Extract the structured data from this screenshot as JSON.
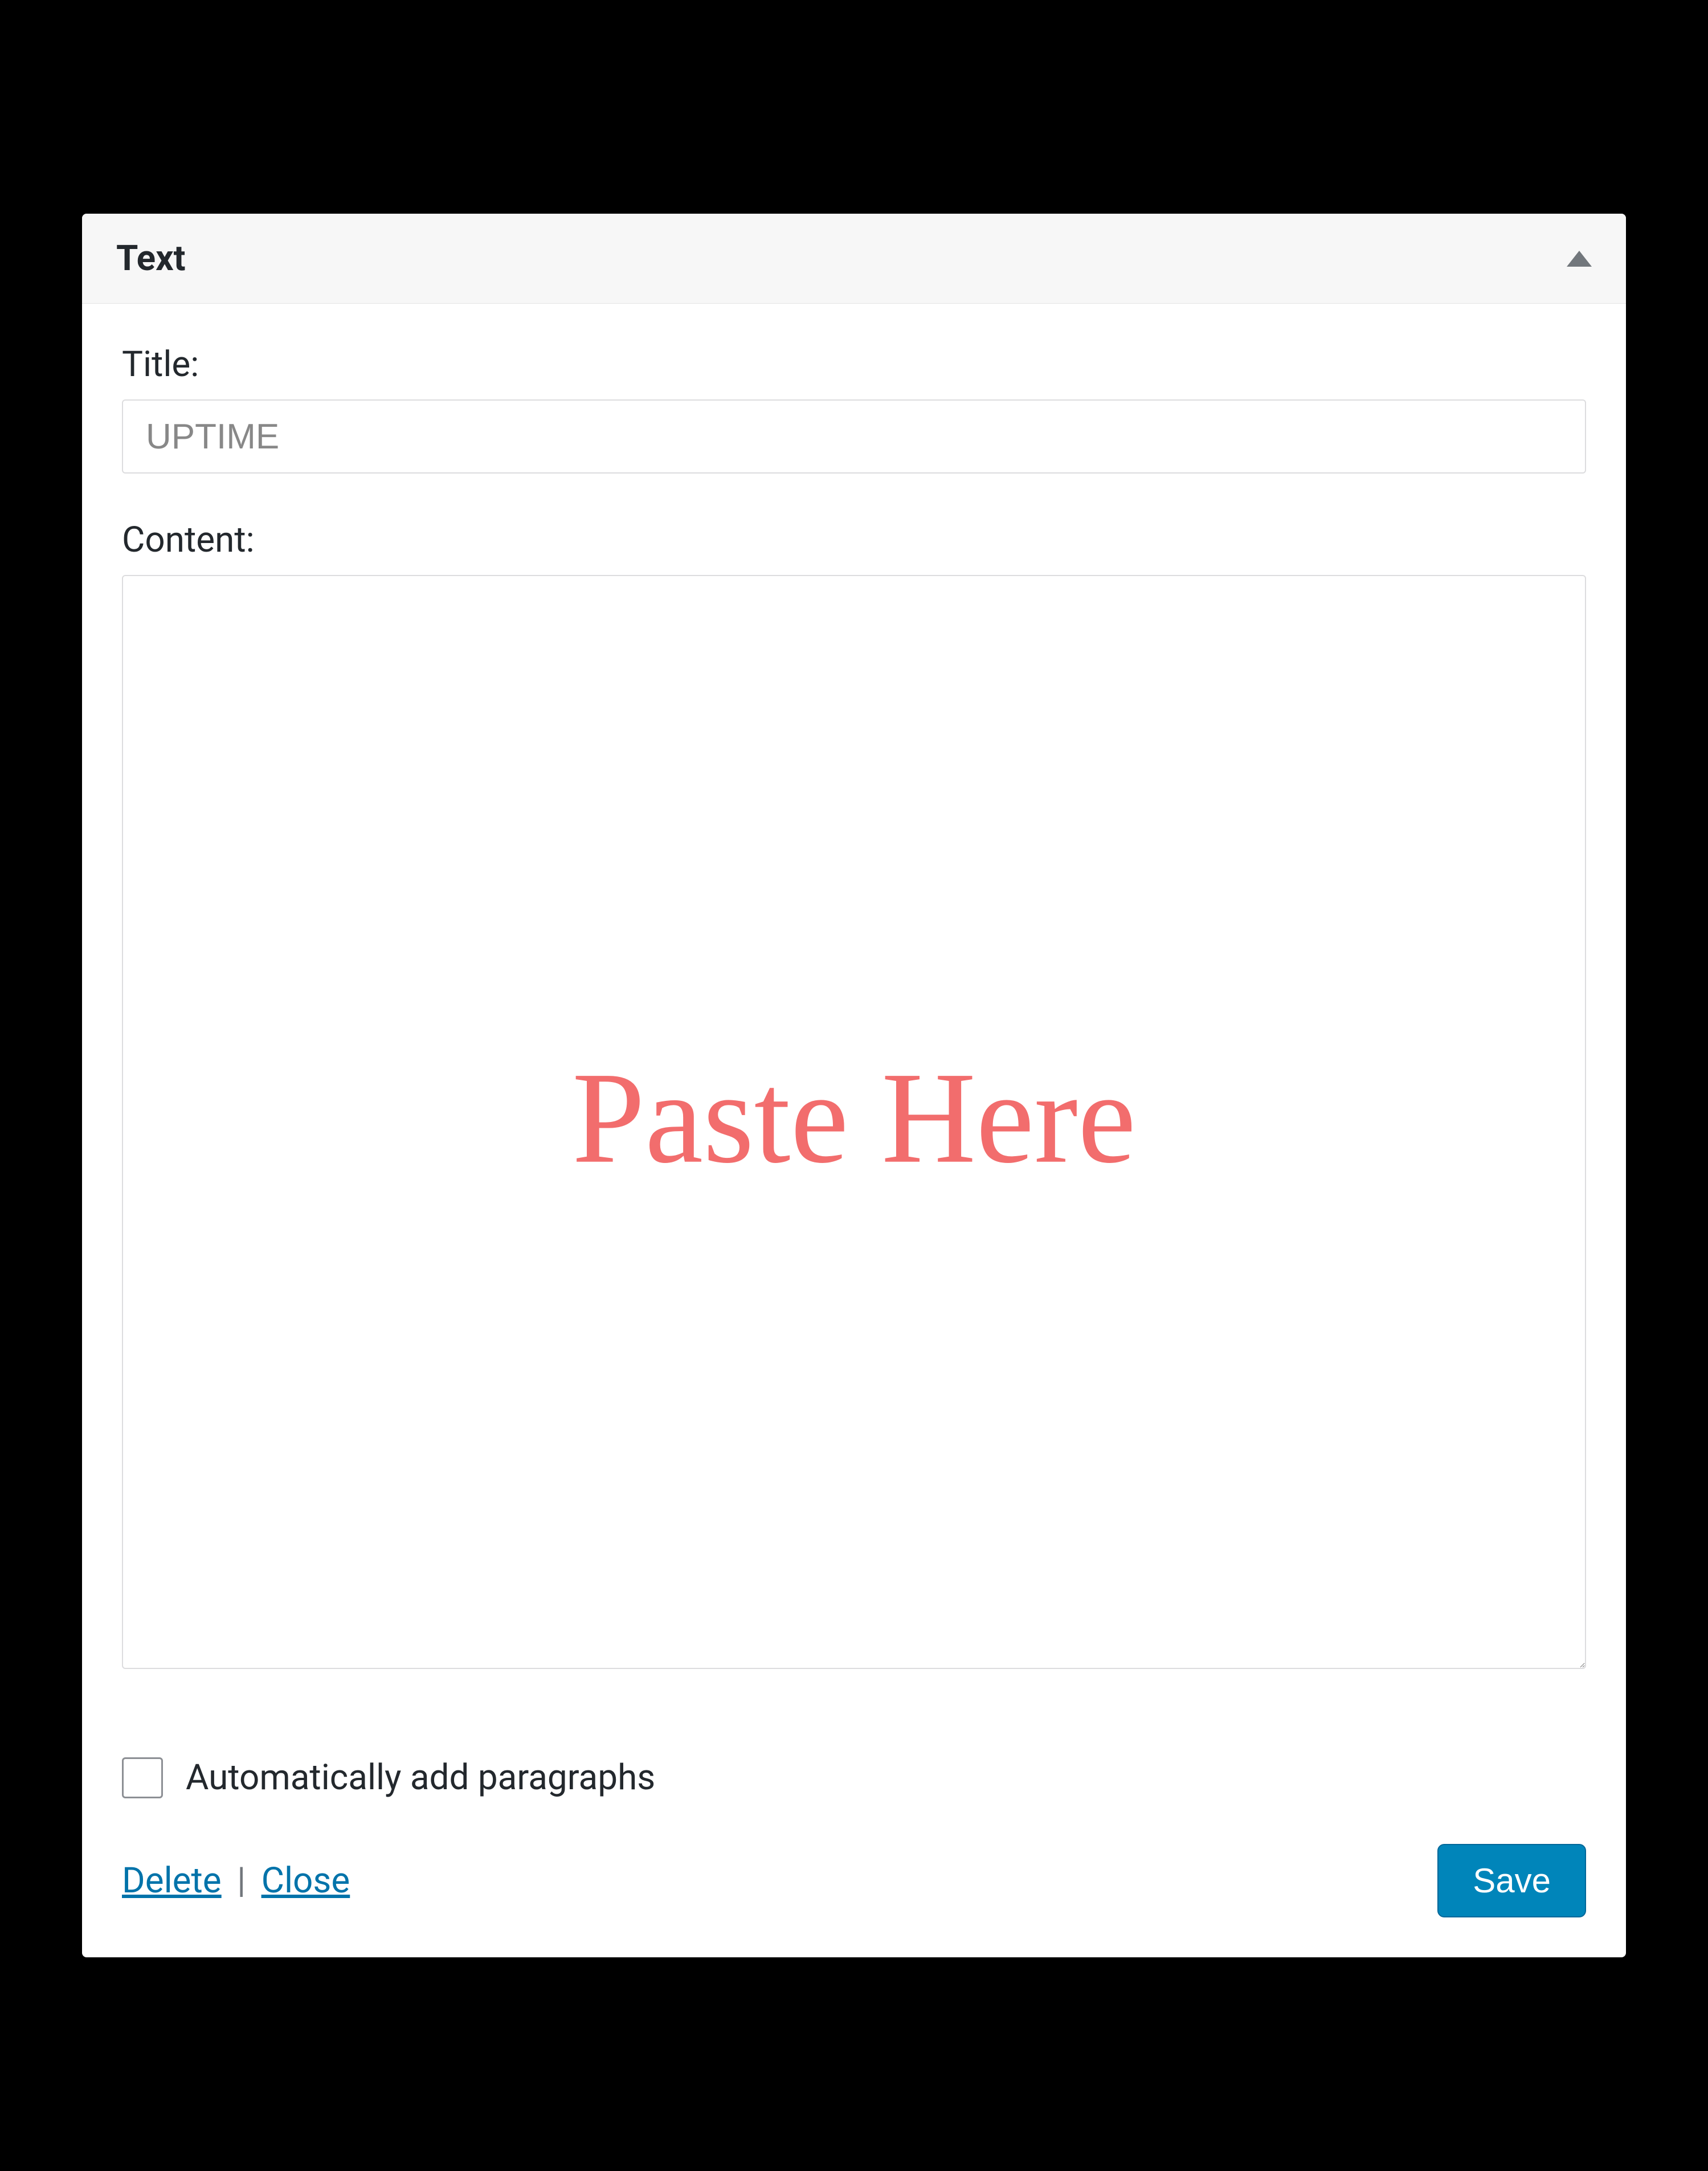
{
  "widget": {
    "header_title": "Text",
    "title_label": "Title:",
    "title_value": "UPTIME",
    "content_label": "Content:",
    "content_value": "",
    "paste_overlay": "Paste Here",
    "checkbox_label": "Automatically add paragraphs",
    "checkbox_checked": false,
    "delete_label": "Delete",
    "close_label": "Close",
    "separator": " | ",
    "save_label": "Save"
  }
}
